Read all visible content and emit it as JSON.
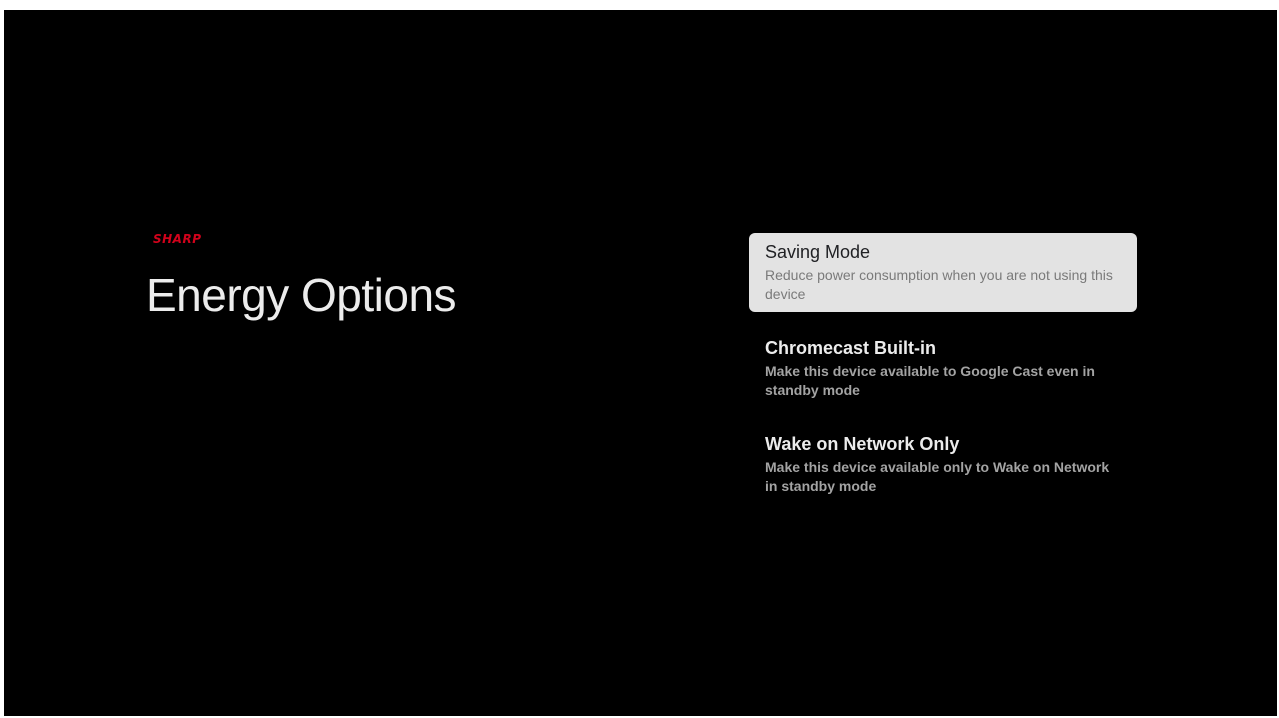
{
  "brand": {
    "logo_text": "SHARP",
    "color": "#d0021b"
  },
  "page": {
    "title": "Energy Options"
  },
  "menu": {
    "items": [
      {
        "title": "Saving Mode",
        "description": "Reduce power consumption when you are not using this device",
        "focused": true
      },
      {
        "title": "Chromecast Built-in",
        "description": "Make this device available to Google Cast even in standby mode",
        "focused": false
      },
      {
        "title": "Wake on Network Only",
        "description": "Make this device available only to Wake on Network in standby mode",
        "focused": false
      }
    ]
  },
  "colors": {
    "background": "#000000",
    "focus_highlight": "#e3e3e3",
    "text_primary": "#ececec",
    "text_secondary": "#a3a3a3"
  }
}
